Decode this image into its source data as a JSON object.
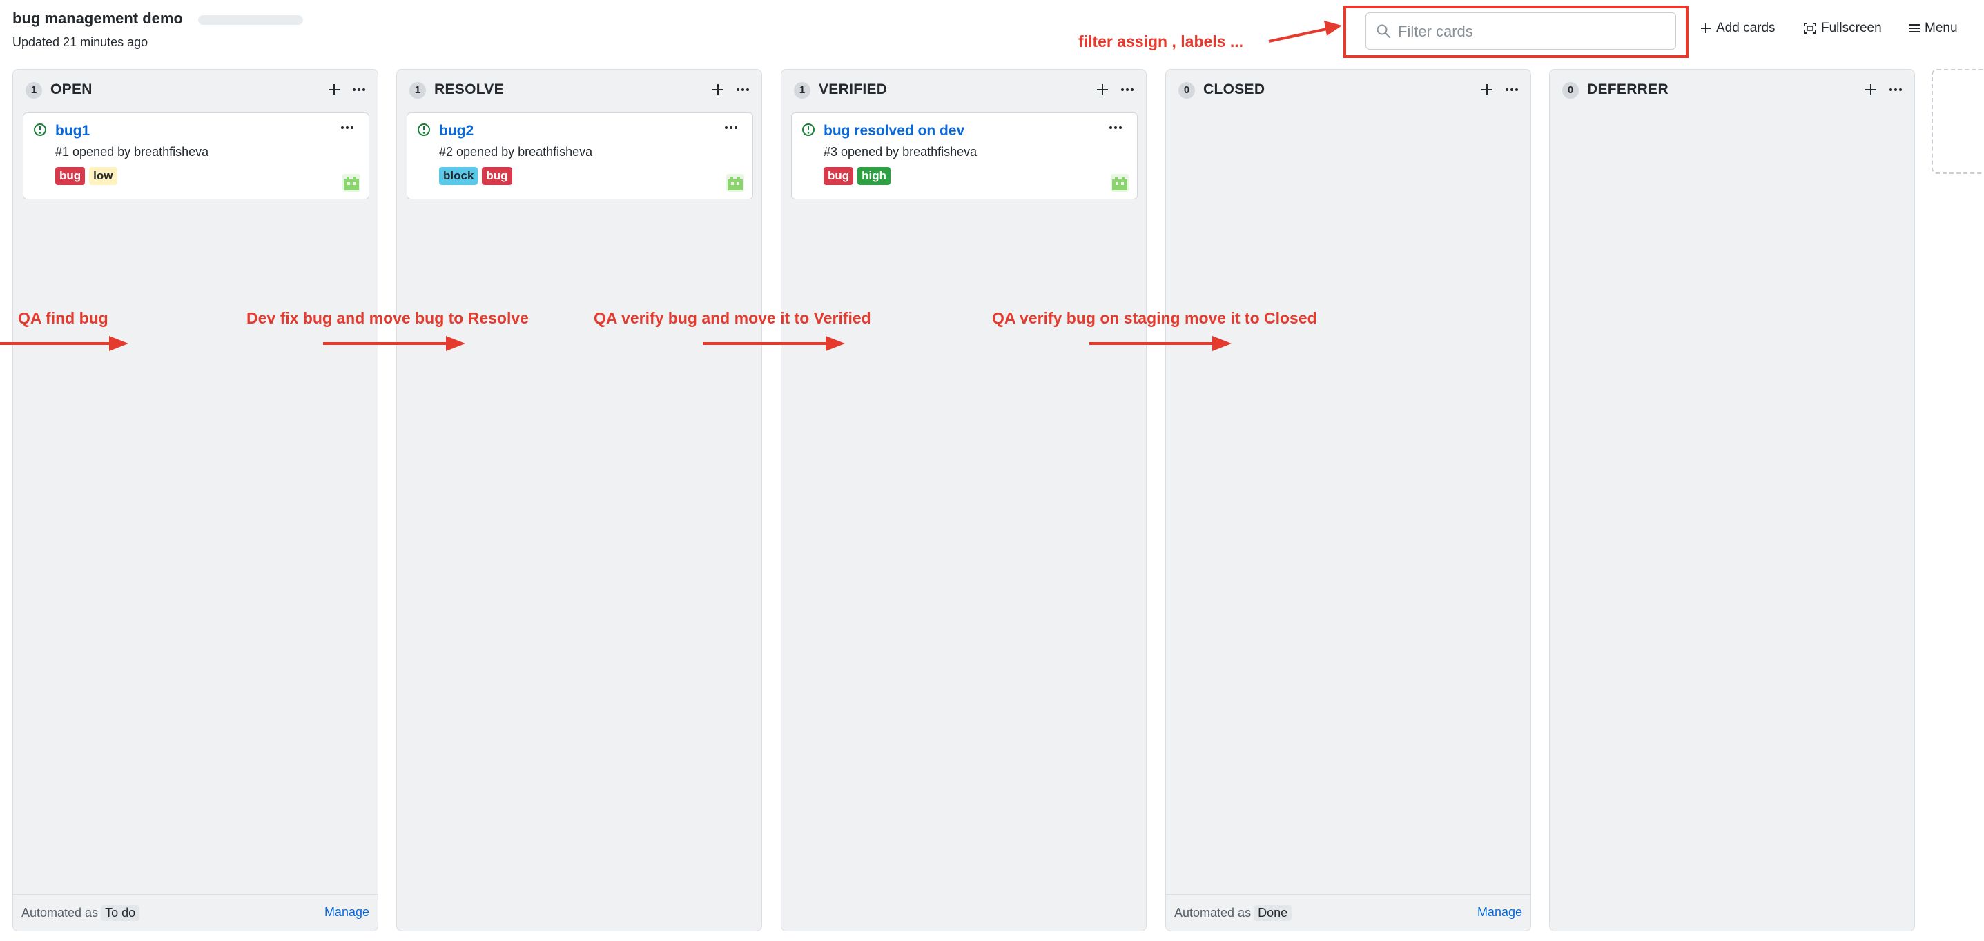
{
  "header": {
    "title": "bug management demo",
    "updated": "Updated 21 minutes ago"
  },
  "toolbar": {
    "filter_placeholder": "Filter cards",
    "add_cards_label": "Add cards",
    "fullscreen_label": "Fullscreen",
    "menu_label": "Menu"
  },
  "columns": [
    {
      "count": "1",
      "name": "OPEN",
      "footer": {
        "automated_as": "Automated as",
        "tag": "To do",
        "manage": "Manage"
      },
      "cards": [
        {
          "title": "bug1",
          "meta_prefix": "#1 opened by",
          "author": "breathfisheva",
          "labels": [
            {
              "text": "bug",
              "color": "#d73a4a",
              "text_color": "#ffffff"
            },
            {
              "text": "low",
              "color": "#fef2c0",
              "text_color": "#24292e"
            }
          ]
        }
      ]
    },
    {
      "count": "1",
      "name": "RESOLVE",
      "cards": [
        {
          "title": "bug2",
          "meta_prefix": "#2 opened by",
          "author": "breathfisheva",
          "labels": [
            {
              "text": "block",
              "color": "#5ac8e8",
              "text_color": "#24292e"
            },
            {
              "text": "bug",
              "color": "#d73a4a",
              "text_color": "#ffffff"
            }
          ]
        }
      ]
    },
    {
      "count": "1",
      "name": "VERIFIED",
      "cards": [
        {
          "title": "bug resolved on dev",
          "meta_prefix": "#3 opened by",
          "author": "breathfisheva",
          "labels": [
            {
              "text": "bug",
              "color": "#d73a4a",
              "text_color": "#ffffff"
            },
            {
              "text": "high",
              "color": "#2ea043",
              "text_color": "#ffffff"
            }
          ]
        }
      ]
    },
    {
      "count": "0",
      "name": "CLOSED",
      "footer": {
        "automated_as": "Automated as",
        "tag": "Done",
        "manage": "Manage"
      },
      "cards": []
    },
    {
      "count": "0",
      "name": "DEFERRER",
      "cards": []
    }
  ],
  "annotations": {
    "filter_note": "filter assign , labels ...",
    "qa_find": "QA find bug",
    "dev_fix": "Dev fix bug and move bug to Resolve",
    "qa_verify": "QA verify bug and move it to Verified",
    "qa_staging": "QA verify bug on staging move it to Closed",
    "color": "#e53b2f"
  },
  "colors": {
    "link": "#0969da",
    "open_issue_icon": "#1a7f37",
    "column_bg": "#f0f1f3"
  }
}
